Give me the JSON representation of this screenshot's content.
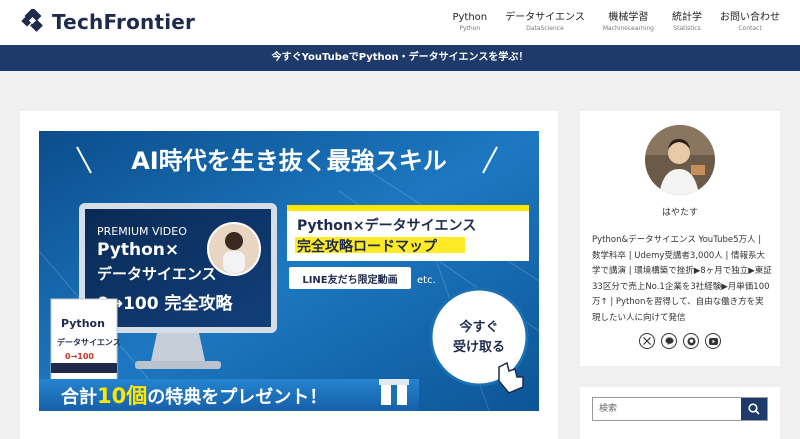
{
  "header": {
    "logo_text": "TechFrontier",
    "nav": [
      {
        "label": "Python",
        "sub": "Python"
      },
      {
        "label": "データサイエンス",
        "sub": "DataScience"
      },
      {
        "label": "機械学習",
        "sub": "MachineLearning"
      },
      {
        "label": "統計学",
        "sub": "Statistics"
      },
      {
        "label": "お問い合わせ",
        "sub": "Contact"
      }
    ]
  },
  "announcement": "今すぐYouTubeでPython・データサイエンスを学ぶ！",
  "banner": {
    "headline": "AI時代を生き抜く最強スキル",
    "video_label": "PREMIUM VIDEO",
    "video_title_1": "Python×",
    "video_title_2": "データサイエンス",
    "video_title_3": "0→100  完全攻略",
    "roadmap_1": "Python×データサイエンス",
    "roadmap_2": "完全攻略ロードマップ",
    "line_badge": "LINE友だち限定動画",
    "etc": "etc.",
    "book_title_1": "Python",
    "book_title_2": "データサイエンス",
    "book_title_3": "0→100",
    "cta_1": "今すぐ",
    "cta_2": "受け取る",
    "present_pre": "合計",
    "present_num": "10個",
    "present_post": "の特典をプレゼント！"
  },
  "profile": {
    "name": "はやたす",
    "bio": "Python&データサイエンス YouTube5万人 | 数学科卒 | Udemy受講者3,000人 | 情報系大学で講演 | 環境構築で挫折▶8ヶ月で独立▶東証33区分で売上No.1企業を3社経験▶月単価100万↑ | Pythonを習得して、自由な働き方を実現したい人に向けて発信"
  },
  "search": {
    "placeholder": "検索"
  },
  "colors": {
    "brand_navy": "#1f2b4d",
    "announce_bg": "#1e3a6a",
    "banner_blue": "#1b6fb3",
    "accent_yellow": "#ffe600"
  }
}
